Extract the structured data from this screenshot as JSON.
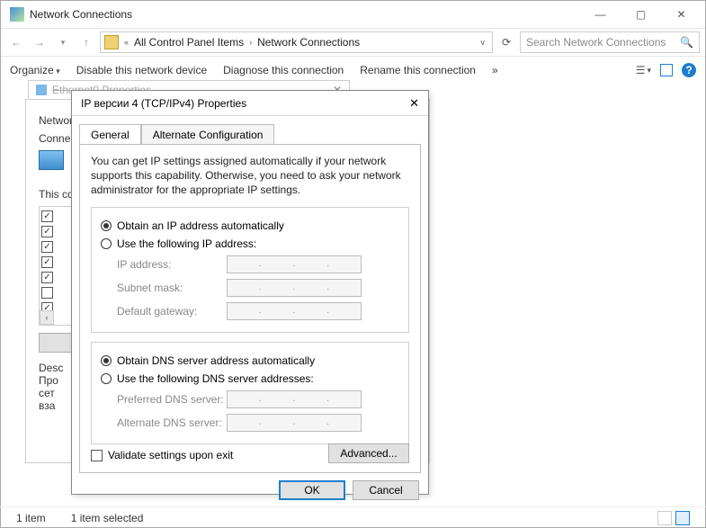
{
  "window": {
    "title": "Network Connections"
  },
  "breadcrumb": {
    "item1": "All Control Panel Items",
    "item2": "Network Connections"
  },
  "search": {
    "placeholder": "Search Network Connections"
  },
  "cmdbar": {
    "organize": "Organize",
    "disable": "Disable this network device",
    "diagnose": "Diagnose this connection",
    "rename": "Rename this connection"
  },
  "bgpanel": {
    "networking": "Network",
    "connect": "Conne",
    "thisconn": "This co",
    "desc": "Desc",
    "line1": "Про",
    "line2": "сет",
    "line3": "вза"
  },
  "ethdlg": {
    "title": "Ethernet0 Properties"
  },
  "dialog": {
    "title": "IP версии 4 (TCP/IPv4) Properties",
    "tabs": {
      "general": "General",
      "alternate": "Alternate Configuration"
    },
    "info": "You can get IP settings assigned automatically if your network supports this capability. Otherwise, you need to ask your network administrator for the appropriate IP settings.",
    "ip": {
      "auto": "Obtain an IP address automatically",
      "manual": "Use the following IP address:",
      "ipaddr": "IP address:",
      "subnet": "Subnet mask:",
      "gateway": "Default gateway:"
    },
    "dns": {
      "auto": "Obtain DNS server address automatically",
      "manual": "Use the following DNS server addresses:",
      "preferred": "Preferred DNS server:",
      "alternate": "Alternate DNS server:"
    },
    "validate": "Validate settings upon exit",
    "advanced": "Advanced...",
    "ok": "OK",
    "cancel": "Cancel"
  },
  "status": {
    "items": "1 item",
    "selected": "1 item selected"
  }
}
